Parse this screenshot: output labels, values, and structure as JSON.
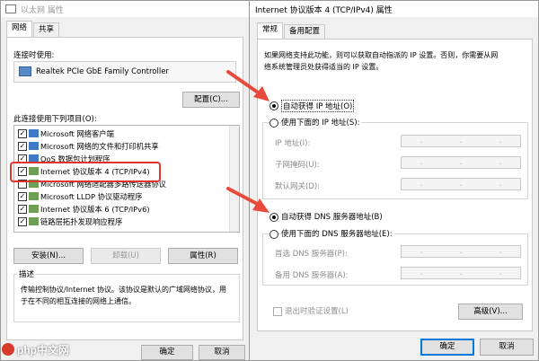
{
  "left_window": {
    "title": "以太网 属性",
    "tabs": [
      "网络",
      "共享"
    ],
    "connect_using_label": "连接时使用:",
    "adapter_name": "Realtek PCIe GbE Family Controller",
    "configure_button": "配置(C)...",
    "items_label": "此连接使用下列项目(O):",
    "items": [
      {
        "label": "Microsoft 网络客户端",
        "checked": true
      },
      {
        "label": "Microsoft 网络的文件和打印机共享",
        "checked": true
      },
      {
        "label": "QoS 数据包计划程序",
        "checked": true
      },
      {
        "label": "Internet 协议版本 4 (TCP/IPv4)",
        "checked": true
      },
      {
        "label": "Microsoft 网络适配器多路传送器协议",
        "checked": false
      },
      {
        "label": "Microsoft LLDP 协议驱动程序",
        "checked": true
      },
      {
        "label": "Internet 协议版本 6 (TCP/IPv6)",
        "checked": true
      },
      {
        "label": "链路层拓扑发现响应程序",
        "checked": true
      }
    ],
    "install_button": "安装(N)...",
    "uninstall_button": "卸载(U)",
    "properties_button": "属性(R)",
    "description_heading": "描述",
    "description_text_1": "传输控制协议/Internet 协议。该协议是默认的广域网络协议，用",
    "description_text_2": "于在不同的相互连接的网络上通信。",
    "ok_button": "确定",
    "cancel_button": "取消"
  },
  "right_window": {
    "title": "Internet 协议版本 4 (TCP/IPv4) 属性",
    "tabs": [
      "常规",
      "备用配置"
    ],
    "intro_1": "如果网络支持此功能，则可以获取自动指派的 IP 设置。否则，你需要从网",
    "intro_2": "络系统管理员处获得适当的 IP 设置。",
    "auto_ip_label": "自动获得 IP 地址(O)",
    "manual_ip_label": "使用下面的 IP 地址(S):",
    "ip_address_label": "IP 地址(I):",
    "subnet_label": "子网掩码(U):",
    "gateway_label": "默认网关(D):",
    "auto_dns_label": "自动获得 DNS 服务器地址(B)",
    "manual_dns_label": "使用下面的 DNS 服务器地址(E):",
    "preferred_dns_label": "首选 DNS 服务器(P):",
    "alternate_dns_label": "备用 DNS 服务器(A):",
    "validate_label": "退出时验证设置(L)",
    "advanced_button": "高级(V)...",
    "ok_button": "确定",
    "cancel_button": "取消"
  },
  "watermark": "php中文网",
  "colors": {
    "highlight_box": "#e0322e",
    "arrow": "#e64b3c",
    "window_bg": "#f0f0f0",
    "accent": "#0078d7"
  }
}
